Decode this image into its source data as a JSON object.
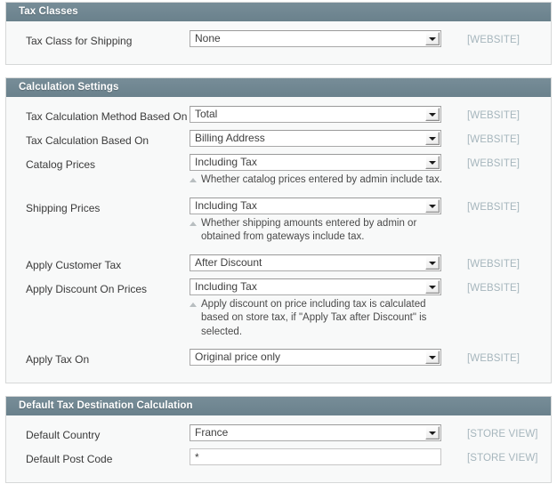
{
  "colors": {
    "section_header_bg": "#6e8691",
    "section_header_text": "#ffffff",
    "section_body_bg": "#f8f9f9",
    "scope_label": "#a6b6bd",
    "border": "#d6d8d8"
  },
  "sections": [
    {
      "title": "Tax Classes",
      "rows": [
        {
          "label": "Tax Class for Shipping",
          "control": "select",
          "value": "None",
          "scope": "[WEBSITE]",
          "hint": ""
        }
      ]
    },
    {
      "title": "Calculation Settings",
      "rows": [
        {
          "label": "Tax Calculation Method Based On",
          "control": "select",
          "value": "Total",
          "scope": "[WEBSITE]",
          "hint": ""
        },
        {
          "label": "Tax Calculation Based On",
          "control": "select",
          "value": "Billing Address",
          "scope": "[WEBSITE]",
          "hint": ""
        },
        {
          "label": "Catalog Prices",
          "control": "select",
          "value": "Including Tax",
          "scope": "[WEBSITE]",
          "hint": "Whether catalog prices entered by admin include tax."
        },
        {
          "label": "Shipping Prices",
          "control": "select",
          "value": "Including Tax",
          "scope": "[WEBSITE]",
          "hint": "Whether shipping amounts entered by admin or obtained from gateways include tax."
        },
        {
          "label": "Apply Customer Tax",
          "control": "select",
          "value": "After Discount",
          "scope": "[WEBSITE]",
          "hint": ""
        },
        {
          "label": "Apply Discount On Prices",
          "control": "select",
          "value": "Including Tax",
          "scope": "[WEBSITE]",
          "hint": "Apply discount on price including tax is calculated based on store tax, if \"Apply Tax after Discount\" is selected."
        },
        {
          "label": "Apply Tax On",
          "control": "select",
          "value": "Original price only",
          "scope": "[WEBSITE]",
          "hint": ""
        }
      ]
    },
    {
      "title": "Default Tax Destination Calculation",
      "rows": [
        {
          "label": "Default Country",
          "control": "select",
          "value": "France",
          "scope": "[STORE VIEW]",
          "hint": ""
        },
        {
          "label": "Default Post Code",
          "control": "text",
          "value": "*",
          "scope": "[STORE VIEW]",
          "hint": ""
        }
      ]
    }
  ]
}
